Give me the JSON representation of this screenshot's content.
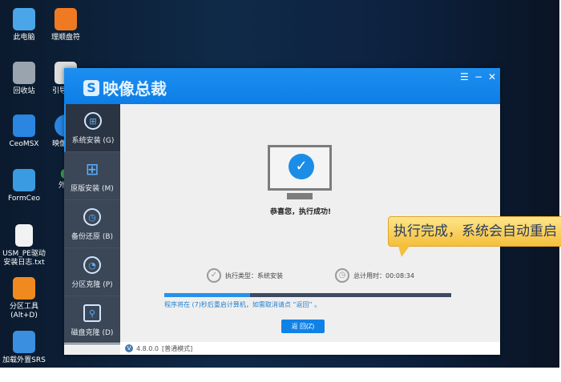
{
  "desktop": {
    "icons": [
      {
        "label": "此电脑",
        "icon": "computer-icon"
      },
      {
        "label": "理顺盘符",
        "icon": "a-z-icon"
      },
      {
        "label": "回收站",
        "icon": "recycle-bin-icon"
      },
      {
        "label": "引导(Alt",
        "icon": "toolbox-icon"
      },
      {
        "label": "CeoMSX",
        "icon": "ceomsx-icon"
      },
      {
        "label": "映像(Alt",
        "icon": "ghost-icon"
      },
      {
        "label": "FormCeo",
        "icon": "formceo-icon"
      },
      {
        "label": "外置",
        "icon": "external-icon"
      },
      {
        "label": "USM_PE驱动安装日志.txt",
        "icon": "text-file-icon"
      },
      {
        "label": "分区工具(Alt+D)",
        "icon": "diskgenius-icon"
      },
      {
        "label": "加载外置SRS",
        "icon": "firewire-icon"
      }
    ]
  },
  "window": {
    "title": "映像总裁",
    "logo_letter": "S"
  },
  "sidebar": {
    "items": [
      {
        "label": "系统安装 (G)"
      },
      {
        "label": "原版安装 (M)"
      },
      {
        "label": "备份还原 (B)"
      },
      {
        "label": "分区克隆 (P)"
      },
      {
        "label": "磁盘克隆 (D)"
      }
    ]
  },
  "main": {
    "congrats": "恭喜您，执行成功!",
    "tooltip": "执行完成，系统会自动重启",
    "exec_type": "执行类型：系统安装",
    "total_time": "总计用时：00:08:34",
    "progress_percent": 30,
    "restart_note": "程序将在 (7)秒后重启计算机，如需取消请点 “返回” 。",
    "back_button": "返 回(Z)"
  },
  "status": {
    "version": "4.8.0.0",
    "mode": "[普通模式]",
    "v_letter": "V"
  },
  "colors": {
    "accent": "#1082e6",
    "sidebar": "#3b4656",
    "tooltip": "#f5bf3c"
  }
}
